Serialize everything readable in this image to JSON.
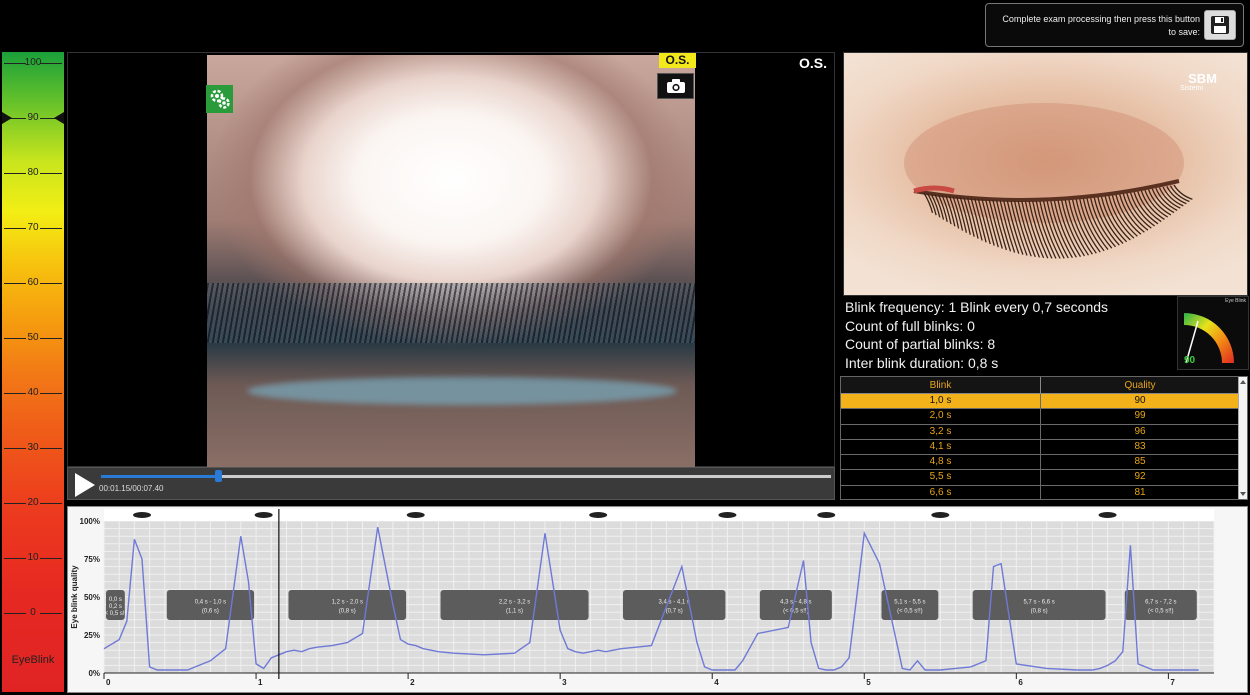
{
  "save_panel": {
    "text": "Complete exam processing then press this button to save:",
    "icon": "floppy-disk-icon"
  },
  "scale": {
    "ticks": [
      "100",
      "90",
      "80",
      "70",
      "60",
      "50",
      "40",
      "30",
      "20",
      "10",
      "0"
    ],
    "marker_value": 90,
    "brand": "EyeBlink"
  },
  "video": {
    "eye_badge": "O.S.",
    "eye_label": "O.S.",
    "timecode": "00:01.15/00:07.40",
    "progress": 0.16
  },
  "illustration": {
    "brand": "SBM",
    "brand_sub": "Sistemi"
  },
  "stats": {
    "frequency": "Blink frequency:  1 Blink every  0,7 seconds",
    "full_blinks": "Count of full blinks:  0",
    "partial_blinks": "Count of partial blinks: 8",
    "inter_blink": "Inter blink duration: 0,8 s"
  },
  "gauge": {
    "title": "Eye Blink",
    "value": "90"
  },
  "blink_table": {
    "headers": [
      "Blink",
      "Quality"
    ],
    "rows": [
      {
        "blink": "1,0 s",
        "quality": "90",
        "selected": true
      },
      {
        "blink": "2,0 s",
        "quality": "99",
        "selected": false
      },
      {
        "blink": "3,2 s",
        "quality": "96",
        "selected": false
      },
      {
        "blink": "4,1 s",
        "quality": "83",
        "selected": false
      },
      {
        "blink": "4,8 s",
        "quality": "85",
        "selected": false
      },
      {
        "blink": "5,5 s",
        "quality": "92",
        "selected": false
      },
      {
        "blink": "6,6 s",
        "quality": "81",
        "selected": false
      }
    ]
  },
  "chart_data": {
    "type": "line",
    "ylabel": "Eye blink quality",
    "y_ticks": [
      "100%",
      "75%",
      "50%",
      "25%",
      "0%"
    ],
    "x_ticks": [
      "0",
      "1",
      "2",
      "3",
      "4",
      "5",
      "6",
      "7"
    ],
    "xlim": [
      0,
      7.3
    ],
    "ylim": [
      0,
      100
    ],
    "cursor_x": 1.15,
    "series": [
      {
        "color": "#6f79d6",
        "x": [
          0,
          0.1,
          0.15,
          0.2,
          0.25,
          0.3,
          0.35,
          0.4,
          0.45,
          0.5,
          0.55,
          0.6,
          0.7,
          0.8,
          0.9,
          0.95,
          1.0,
          1.05,
          1.1,
          1.15,
          1.2,
          1.25,
          1.3,
          1.35,
          1.4,
          1.5,
          1.6,
          1.7,
          1.8,
          1.9,
          1.95,
          2.0,
          2.05,
          2.1,
          2.2,
          2.3,
          2.5,
          2.7,
          2.8,
          2.9,
          3.0,
          3.05,
          3.1,
          3.15,
          3.25,
          3.3,
          3.4,
          3.6,
          3.8,
          3.9,
          3.95,
          4.0,
          4.05,
          4.1,
          4.15,
          4.2,
          4.3,
          4.5,
          4.6,
          4.65,
          4.7,
          4.75,
          4.8,
          4.85,
          4.9,
          4.95,
          5.0,
          5.1,
          5.25,
          5.3,
          5.35,
          5.4,
          5.45,
          5.5,
          5.6,
          5.7,
          5.8,
          5.85,
          5.9,
          6.0,
          6.2,
          6.4,
          6.5,
          6.55,
          6.6,
          6.65,
          6.7,
          6.75,
          6.8,
          6.9,
          7.0,
          7.05,
          7.1,
          7.15,
          7.2
        ],
        "y": [
          16,
          22,
          34,
          88,
          75,
          4,
          2,
          2,
          2,
          2,
          2,
          4,
          8,
          16,
          90,
          60,
          6,
          3,
          10,
          12,
          14,
          15,
          14,
          16,
          17,
          18,
          20,
          26,
          96,
          45,
          22,
          19,
          18,
          16,
          14,
          13,
          12,
          13,
          20,
          92,
          28,
          16,
          14,
          13,
          15,
          14,
          16,
          18,
          70,
          20,
          4,
          2,
          2,
          2,
          2,
          8,
          26,
          30,
          74,
          20,
          3,
          2,
          2,
          4,
          10,
          50,
          92,
          72,
          3,
          2,
          8,
          2,
          2,
          2,
          3,
          4,
          8,
          70,
          72,
          6,
          3,
          2,
          2,
          3,
          5,
          8,
          14,
          84,
          6,
          2,
          2,
          2,
          2,
          2,
          2
        ]
      }
    ],
    "annotations": [
      {
        "x1": 0.0,
        "x2": 0.15,
        "top": "0,0 s",
        "mid": "0,2 s",
        "bot": "(< 0,5 s!!)"
      },
      {
        "x1": 0.4,
        "x2": 1.0,
        "top": "0,4 s - 1,0 s",
        "bot": "(0,6 s)"
      },
      {
        "x1": 1.2,
        "x2": 2.0,
        "top": "1,2 s - 2,0 s",
        "bot": "(0,8 s)"
      },
      {
        "x1": 2.2,
        "x2": 3.2,
        "top": "2,2 s - 3,2 s",
        "bot": "(1,1 s)"
      },
      {
        "x1": 3.4,
        "x2": 4.1,
        "top": "3,4 s - 4,1 s",
        "bot": "(0,7 s)"
      },
      {
        "x1": 4.3,
        "x2": 4.8,
        "top": "4,3 s - 4,8 s",
        "bot": "(< 0,5 s!!)"
      },
      {
        "x1": 5.1,
        "x2": 5.5,
        "top": "5,1 s - 5,5 s",
        "bot": "(< 0,5 s!!)"
      },
      {
        "x1": 5.7,
        "x2": 6.6,
        "top": "5,7 s - 6,6 s",
        "bot": "(0,8 s)"
      },
      {
        "x1": 6.7,
        "x2": 7.2,
        "top": "6,7 s - 7,2 s",
        "bot": "(< 0,5 s!!)"
      }
    ],
    "eye_markers_x": [
      0.25,
      1.05,
      2.05,
      3.25,
      4.1,
      4.75,
      5.5,
      6.6
    ]
  }
}
